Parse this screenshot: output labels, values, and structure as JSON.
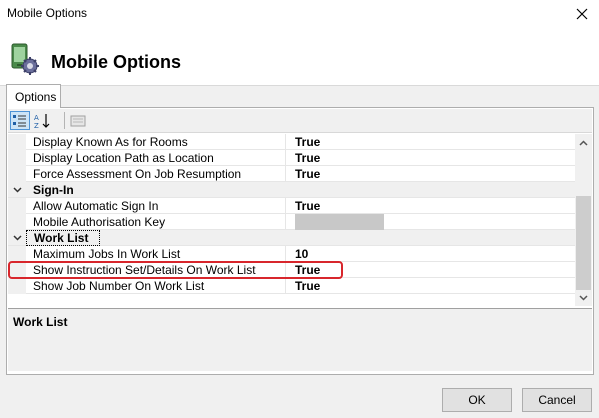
{
  "window": {
    "title": "Mobile Options"
  },
  "header": {
    "title": "Mobile Options",
    "icon": "mobile-settings-icon"
  },
  "tabs": [
    {
      "label": "Options",
      "selected": true
    }
  ],
  "toolbar": {
    "buttons": [
      {
        "icon": "categorized-icon",
        "active": true
      },
      {
        "icon": "alphabetical-sort-icon",
        "active": false
      },
      {
        "icon": "property-pages-icon",
        "active": false
      }
    ]
  },
  "grid": {
    "rows": [
      {
        "name": "Display Known As for Rooms",
        "value": "True"
      },
      {
        "name": "Display Location Path as Location",
        "value": "True"
      },
      {
        "name": "Force Assessment On Job Resumption",
        "value": "True"
      },
      {
        "category": "Sign-In",
        "expanded": true
      },
      {
        "name": "Allow Automatic Sign In",
        "value": "True"
      },
      {
        "name": "Mobile Authorisation Key",
        "value": ""
      },
      {
        "category": "Work List",
        "expanded": true
      },
      {
        "name": "Maximum Jobs In Work List",
        "value": "10"
      },
      {
        "name": "Show Instruction Set/Details On Work List",
        "value": "True",
        "highlighted": true
      },
      {
        "name": "Show Job Number On Work List",
        "value": "True"
      }
    ]
  },
  "description": {
    "title": "Work List"
  },
  "buttons": {
    "ok": "OK",
    "cancel": "Cancel"
  },
  "colors": {
    "highlight_border": "#d8262c",
    "selected_button_bg": "#cce4f7"
  }
}
